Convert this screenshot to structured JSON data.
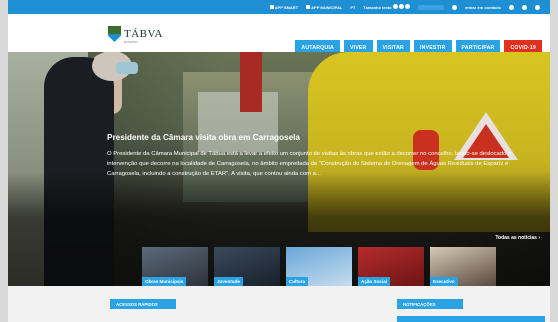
{
  "topbar": {
    "items": [
      "APP SMART",
      "APP MUNICIPAL",
      "PT",
      "Tamanho texto",
      "entrar em contacto"
    ]
  },
  "header": {
    "logo_text": "TÁBVA",
    "logo_sub": "MUNICÍPIO"
  },
  "nav": [
    {
      "label": "AUTARQUIA"
    },
    {
      "label": "VIVER"
    },
    {
      "label": "VISITAR"
    },
    {
      "label": "INVESTIR"
    },
    {
      "label": "PARTICIPAR"
    },
    {
      "label": "COVID-19"
    }
  ],
  "hero": {
    "title": "Presidente da Câmara visita obra em Carragosela",
    "text": "O Presidente da Câmara Municipal de Tábua está a levar a efeito um conjunto de visitas às obras que estão a decorrer no concelho, tendo-se deslocado à intervenção que decorre na localidade de Carragosela, no âmbito empreitada de \"Construção do Sistema de Drenagem de Águas Residuais de Esparíz e Carragosela, incluindo a construção de ETAR\". A visita, que contou ainda com a...",
    "all_news": "Todas as notícias ›"
  },
  "tiles": [
    {
      "label": "Obras Municipais"
    },
    {
      "label": "Juventude"
    },
    {
      "label": "Cultura"
    },
    {
      "label": "Ação Social"
    },
    {
      "label": "Executivo"
    }
  ],
  "bottom": {
    "quick_access": "ACESSOS RÁPIDOS",
    "notifications": "NOTIFICAÇÕES"
  },
  "colors": {
    "primary": "#2aa3e4",
    "topbar": "#1f8fd3",
    "covid": "#e0301e"
  }
}
